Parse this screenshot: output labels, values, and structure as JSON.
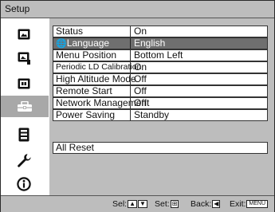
{
  "title": "Setup",
  "sidebar": {
    "icons": [
      {
        "name": "picture-icon",
        "active": false
      },
      {
        "name": "picture-adjust-icon",
        "active": false
      },
      {
        "name": "screen-icon",
        "active": false
      },
      {
        "name": "setup-toolbox-icon",
        "active": true
      },
      {
        "name": "function-icon",
        "active": false
      },
      {
        "name": "wrench-icon",
        "active": false
      },
      {
        "name": "information-icon",
        "active": false
      }
    ]
  },
  "menu": {
    "items": [
      {
        "label": "Status",
        "value": "On",
        "selected": false
      },
      {
        "label": "Language",
        "value": "English",
        "selected": true
      },
      {
        "label": "Menu Position",
        "value": "Bottom Left",
        "selected": false
      },
      {
        "label": "Periodic LD Calibration",
        "value": "On",
        "selected": false
      },
      {
        "label": "High Altitude Mode",
        "value": "Off",
        "selected": false
      },
      {
        "label": "Remote Start",
        "value": "Off",
        "selected": false
      },
      {
        "label": "Network Management",
        "value": "Off",
        "selected": false
      },
      {
        "label": "Power Saving",
        "value": "Standby",
        "selected": false
      }
    ],
    "reset_label": "All Reset"
  },
  "footer": {
    "sel_label": "Sel:",
    "set_label": "Set:",
    "back_label": "Back:",
    "exit_label": "Exit:",
    "exit_key": "MENU"
  }
}
